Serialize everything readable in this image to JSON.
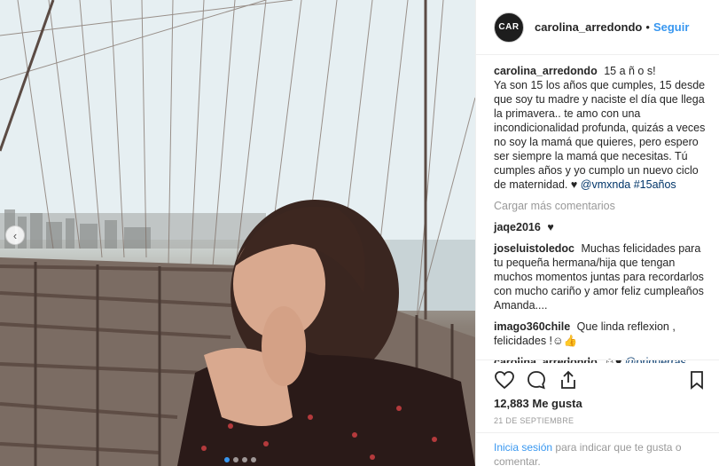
{
  "post": {
    "username": "carolina_arredondo",
    "avatar_text": "CAR",
    "follow_label": "Seguir",
    "separator": "•",
    "caption_title": "15 a ñ o s!",
    "caption_body": "Ya son 15 los años que cumples, 15 desde que soy tu madre y naciste el día que llega la primavera.. te amo con una incondicionalidad profunda, quizás a veces no soy la mamá que quieres, pero espero ser siempre la mamá que necesitas. Tú cumples años y yo cumplo un nuevo ciclo de maternidad. ♥",
    "caption_mention": "@vmxnda",
    "caption_hashtag": "#15años",
    "load_more_label": "Cargar más comentarios",
    "likes_text": "12,883 Me gusta",
    "date_text": "21 DE SEPTIEMBRE",
    "login_link": "Inicia sesión",
    "login_text": "para indicar que te gusta o comentar."
  },
  "comments": [
    {
      "user": "jaqe2016",
      "text": "♥"
    },
    {
      "user": "joseluistoledoc",
      "text": "Muchas felicidades para tu pequeña hermana/hija que tengan muchos momentos juntas para recordarlos con mucho cariño y amor feliz cumpleaños Amanda...."
    },
    {
      "user": "imago360chile",
      "text": "Que linda reflexion , felicidades !☺👍"
    },
    {
      "user": "carolina_arredondo",
      "text": "☺♥",
      "mention": "@priguerras"
    }
  ],
  "carousel": {
    "dot_count": 4,
    "active_index": 0
  },
  "icons": {
    "heart": "heart-icon",
    "comment": "comment-icon",
    "share": "share-icon",
    "save": "bookmark-icon",
    "prev": "chevron-left-icon"
  },
  "colors": {
    "accent": "#3897f0",
    "text": "#262626",
    "muted": "#999999",
    "tag": "#003569"
  }
}
